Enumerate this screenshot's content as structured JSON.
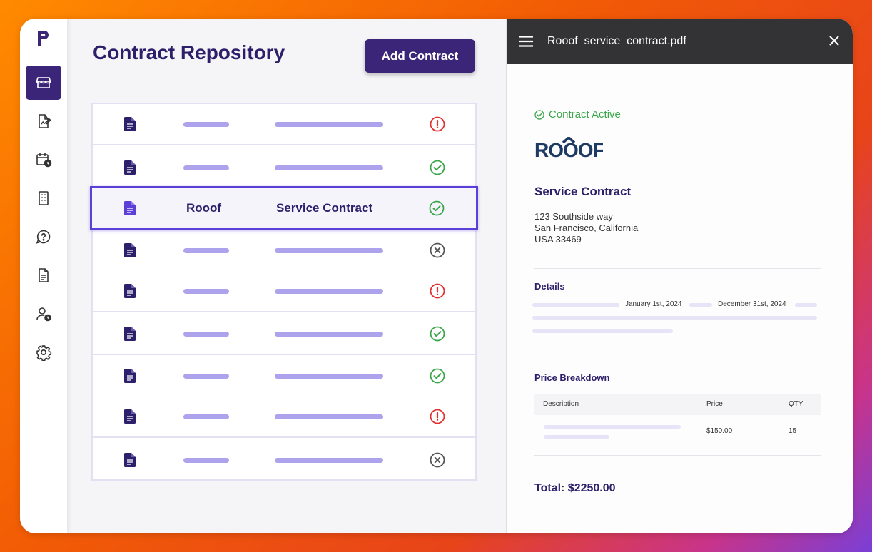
{
  "main": {
    "title": "Contract Repository",
    "add_button": "Add Contract"
  },
  "table": {
    "selected_row": {
      "company": "Rooof",
      "type": "Service Contract"
    },
    "rows": [
      {
        "status": "warning"
      },
      {
        "status": "active"
      },
      {
        "status": "active",
        "selected": true
      },
      {
        "status": "cancelled"
      },
      {
        "status": "warning"
      },
      {
        "status": "active"
      },
      {
        "status": "active"
      },
      {
        "status": "warning"
      },
      {
        "status": "cancelled"
      }
    ]
  },
  "panel": {
    "file_name": "Rooof_service_contract.pdf",
    "status_text": "Contract Active",
    "brand": "ROOOF",
    "doc_title": "Service Contract",
    "address": [
      "123 Southside way",
      "San Francisco, California",
      "USA 33469"
    ],
    "details_title": "Details",
    "start_date": "January 1st, 2024",
    "end_date": "December 31st, 2024",
    "price_title": "Price Breakdown",
    "columns": {
      "description": "Description",
      "price": "Price",
      "qty": "QTY"
    },
    "line_item": {
      "price": "$150.00",
      "qty": "15"
    },
    "total": "Total: $2250.00"
  },
  "colors": {
    "primary": "#3b2578",
    "active": "#3aa64a",
    "warning": "#e03131",
    "cancelled": "#555555",
    "accent_bar": "#ada2ec"
  }
}
